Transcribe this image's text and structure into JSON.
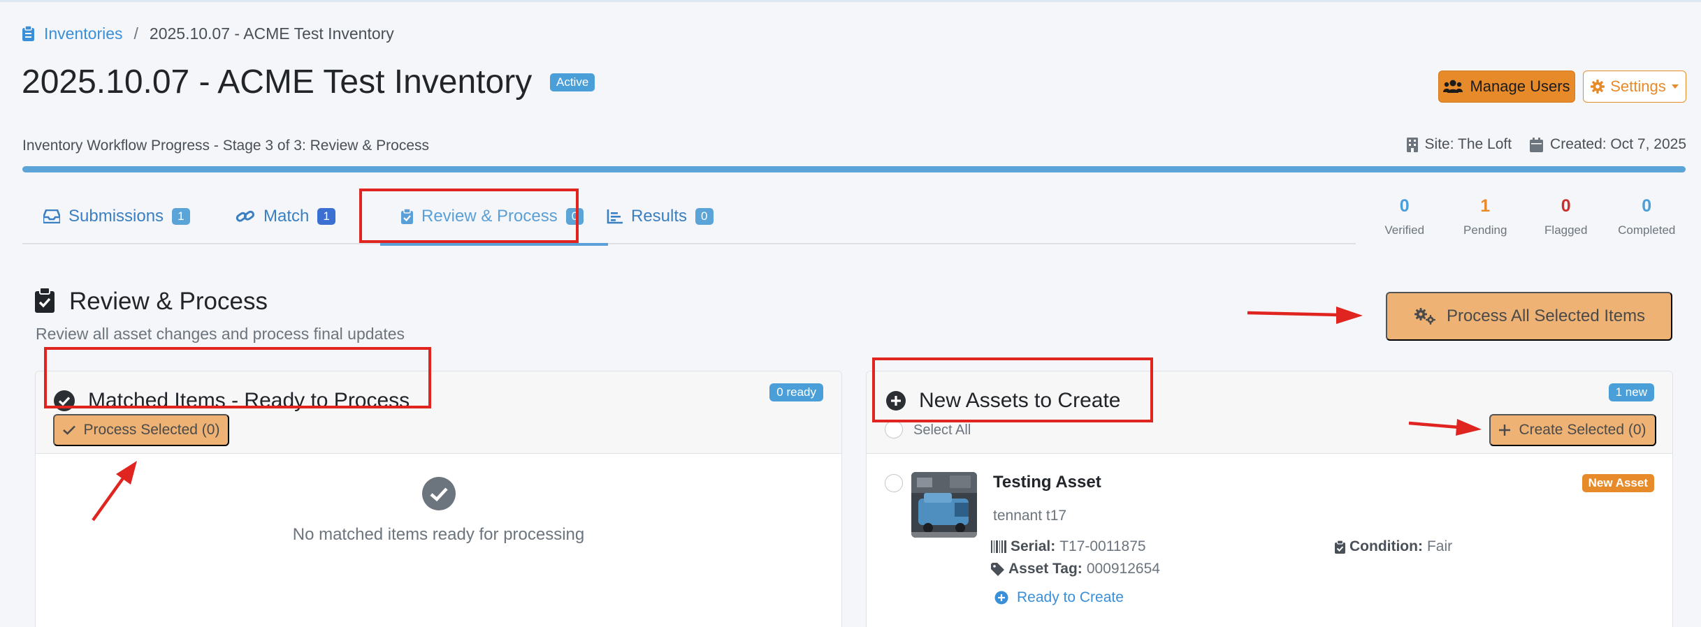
{
  "breadcrumb": {
    "root_label": "Inventories",
    "separator": "/",
    "current": "2025.10.07 - ACME Test Inventory"
  },
  "page": {
    "title": "2025.10.07 - ACME Test Inventory",
    "status_badge": "Active"
  },
  "header_actions": {
    "manage_users_label": "Manage Users",
    "settings_label": "Settings"
  },
  "workflow": {
    "progress_label": "Inventory Workflow Progress - Stage 3 of 3: Review & Process",
    "progress_fraction": 1.0,
    "site": "Site: The Loft",
    "created": "Created: Oct 7, 2025"
  },
  "tabs": [
    {
      "label": "Submissions",
      "count": "1",
      "badge_color": "#5ba4d8"
    },
    {
      "label": "Match",
      "count": "1",
      "badge_color": "#3b6fd1"
    },
    {
      "label": "Review & Process",
      "count": "0",
      "badge_color": "#5ba4d8",
      "active": true
    },
    {
      "label": "Results",
      "count": "0",
      "badge_color": "#5ba4d8"
    }
  ],
  "stats": [
    {
      "value": "0",
      "label": "Verified",
      "color": "#4a9fd8"
    },
    {
      "value": "1",
      "label": "Pending",
      "color": "#e78b2a"
    },
    {
      "value": "0",
      "label": "Flagged",
      "color": "#c9302c"
    },
    {
      "value": "0",
      "label": "Completed",
      "color": "#4a9fd8"
    }
  ],
  "section": {
    "title": "Review & Process",
    "subtitle": "Review all asset changes and process final updates",
    "process_all_label": "Process All Selected Items"
  },
  "matched_card": {
    "title": "Matched Items - Ready to Process",
    "count_badge": "0 ready",
    "process_button": "Process Selected (0)",
    "empty_text": "No matched items ready for processing"
  },
  "new_assets_card": {
    "title": "New Assets to Create",
    "count_badge": "1 new",
    "select_all": "Select All",
    "create_button": "Create Selected (0)",
    "asset": {
      "name": "Testing Asset",
      "subtitle": "tennant t17",
      "badge": "New Asset",
      "serial_label": "Serial:",
      "serial": "T17-0011875",
      "tag_label": "Asset Tag:",
      "tag": "000912654",
      "condition_label": "Condition:",
      "condition": "Fair",
      "status": "Ready to Create"
    }
  },
  "colors": {
    "accent_blue": "#4a9fd8",
    "accent_orange": "#e78b2a",
    "soft_orange": "#edb274",
    "annotation_red": "#e0241f"
  }
}
